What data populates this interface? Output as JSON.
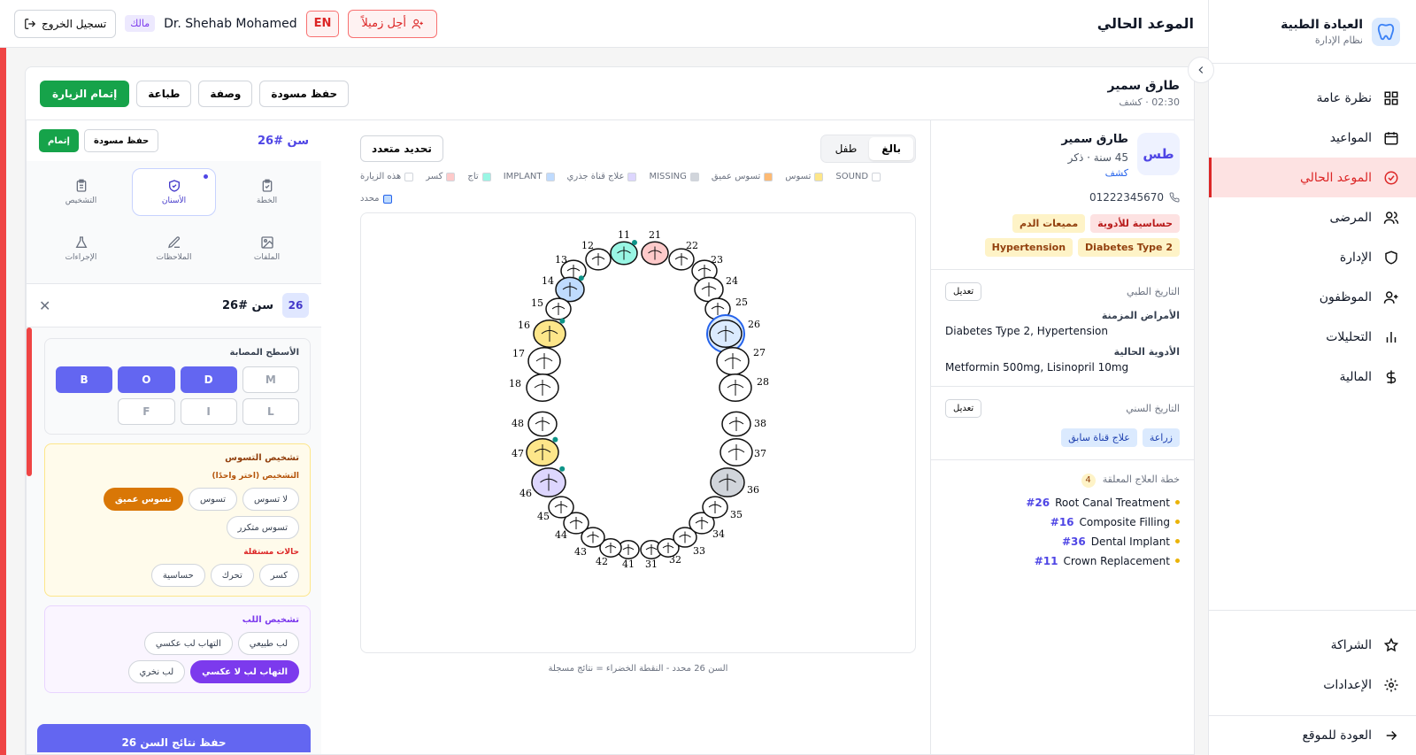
{
  "sidebar": {
    "brand_title": "العيادة الطبية",
    "brand_sub": "نظام الإدارة",
    "items": [
      {
        "label": "نظرة عامة",
        "icon": "grid-icon"
      },
      {
        "label": "المواعيد",
        "icon": "calendar-icon"
      },
      {
        "label": "الموعد الحالي",
        "icon": "check-circle-icon"
      },
      {
        "label": "المرضى",
        "icon": "users-icon"
      },
      {
        "label": "الإدارة",
        "icon": "shield-icon"
      },
      {
        "label": "الموظفون",
        "icon": "user-plus-icon"
      },
      {
        "label": "التحليلات",
        "icon": "bar-chart-icon"
      },
      {
        "label": "المالية",
        "icon": "dollar-icon"
      }
    ],
    "bottom": [
      {
        "label": "الشراكة",
        "icon": "star-icon"
      },
      {
        "label": "الإعدادات",
        "icon": "gear-icon"
      }
    ],
    "back_label": "العودة للموقع"
  },
  "topbar": {
    "title": "الموعد الحالي",
    "refer_label": "أحِل زميلاً",
    "lang": "EN",
    "doctor": "Dr. Shehab Mohamed",
    "role": "مالك",
    "logout": "تسجيل الخروج"
  },
  "visit": {
    "patient_name": "طارق سمير",
    "sub": "02:30 · كشف",
    "save_draft": "حفظ مسودة",
    "prescription": "وصفة",
    "print": "طباعة",
    "complete": "إتمام الزيارة"
  },
  "patient": {
    "initials": "طس",
    "name": "طارق سمير",
    "meta": "45 سنة · ذكر",
    "type": "كشف",
    "phone": "01222345670",
    "tags": [
      {
        "label": "حساسية للأدوية",
        "color": "red"
      },
      {
        "label": "مميعات الدم",
        "color": "yellow"
      },
      {
        "label": "Diabetes Type 2",
        "color": "yellow"
      },
      {
        "label": "Hypertension",
        "color": "yellow"
      }
    ],
    "medical_title": "التاريخ الطبي",
    "edit": "تعديل",
    "chronic_label": "الأمراض المزمنة",
    "chronic_value": "Diabetes Type 2, Hypertension",
    "meds_label": "الأدوية الحالية",
    "meds_value": "Metformin 500mg, Lisinopril 10mg",
    "dental_title": "التاريخ السني",
    "dental_pills": [
      "زراعة",
      "علاج قناة سابق"
    ],
    "plan_title": "خطة العلاج المعلقة",
    "plan_count": "4",
    "plan": [
      {
        "num": "#26",
        "label": "Root Canal Treatment"
      },
      {
        "num": "#16",
        "label": "Composite Filling"
      },
      {
        "num": "#36",
        "label": "Dental Implant"
      },
      {
        "num": "#11",
        "label": "Crown Replacement"
      }
    ]
  },
  "chart": {
    "adult": "بالغ",
    "child": "طفل",
    "multi": "تحديد متعدد",
    "legend": [
      {
        "label": "SOUND",
        "color": "#ffffff"
      },
      {
        "label": "تسوس",
        "color": "#fde68a"
      },
      {
        "label": "تسوس عميق",
        "color": "#fdba74"
      },
      {
        "label": "MISSING",
        "color": "#d1d5db"
      },
      {
        "label": "علاج قناة جذري",
        "color": "#ddd6fe"
      },
      {
        "label": "IMPLANT",
        "color": "#bfdbfe"
      },
      {
        "label": "تاج",
        "color": "#99f6e4"
      },
      {
        "label": "كسر",
        "color": "#fecaca"
      },
      {
        "label": "هذه الزيارة",
        "color": "#ffffff"
      },
      {
        "label": "محدد",
        "color": "#bfdbfe"
      }
    ],
    "note": "السن 26 محدد - النقطة الخضراء = نتائج مسجلة",
    "upper_right": [
      "18",
      "17",
      "16",
      "15",
      "14",
      "13",
      "12",
      "11"
    ],
    "upper_left": [
      "21",
      "22",
      "23",
      "24",
      "25",
      "26",
      "27",
      "28"
    ],
    "lower_left": [
      "38",
      "37",
      "36",
      "35",
      "34",
      "33",
      "32",
      "31"
    ],
    "lower_right": [
      "48",
      "47",
      "46",
      "45",
      "44",
      "43",
      "42",
      "41"
    ]
  },
  "tooth": {
    "title": "سن #26",
    "save_draft": "حفظ مسودة",
    "complete": "إتمام",
    "tabs": [
      "التشخيص",
      "الأسنان",
      "الخطة",
      "الإجراءات",
      "الملاحظات",
      "الملفات"
    ],
    "sel_num": "26",
    "sel_title": "سن #26",
    "surfaces_title": "الأسطح المصابة",
    "surfaces": [
      "M",
      "D",
      "O",
      "B",
      "L",
      "I",
      "F"
    ],
    "caries_title": "تشخيص التسوس",
    "caries_sub": "التشخيص (اختر واحدًا)",
    "caries_opts": [
      "لا تسوس",
      "تسوس",
      "تسوس عميق",
      "تسوس متكرر"
    ],
    "indep_title": "حالات مستقلة",
    "indep_opts": [
      "كسر",
      "تحرك",
      "حساسية"
    ],
    "pulp_title": "تشخيص اللب",
    "pulp_opts": [
      "لب طبيعي",
      "التهاب لب عكسي",
      "التهاب لب لا عكسي",
      "لب نخري"
    ],
    "save_results": "حفظ نتائج السن 26"
  }
}
